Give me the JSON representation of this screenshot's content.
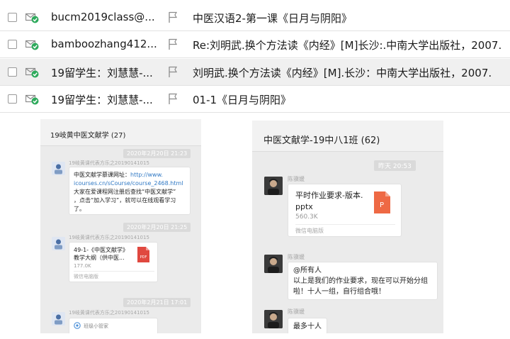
{
  "mail_list": [
    {
      "sender": "bucm2019class@...",
      "subject": "中医汉语2-第一课《日月与阴阳》",
      "selected": false
    },
    {
      "sender": "bamboozhang412...",
      "subject": "Re:刘明武.换个方法读《内经》[M]长沙:.中南大学出版社，2007.",
      "selected": false
    },
    {
      "sender": "19留学生：刘慧慧-...",
      "subject": "刘明武.换个方法读《内经》[M].长沙：中南大学出版社，2007.",
      "selected": true
    },
    {
      "sender": "19留学生：刘慧慧-...",
      "subject": "01-1《日月与阴阳》",
      "selected": false
    }
  ],
  "chat_left": {
    "title": "19岐黄中医文献学 (27)",
    "ts1": "2020年2月20日 21:23",
    "sender1": "19岐黄课代表方乐之20190141015",
    "msg1_line1_prefix": "中医文献学慕课网址：",
    "msg1_link1": "http://www.",
    "msg1_link2": "icourses.cn/sCourse/course_2468.html",
    "msg1_line3": "大家在爱课程网注册后查找“中医文献学”",
    "msg1_line4": "，点击“加入学习”，就可以在线观看学习",
    "msg1_line5": "了。",
    "ts2": "2020年2月20日 21:25",
    "sender2": "19岐黄课代表方乐之20190141015",
    "file_title1": "49-1-《中医文献学》",
    "file_title2": "教学大纲（供中医...",
    "file_size": "177.0K",
    "file_source": "微信电脑版",
    "file_icon_label": "PDF",
    "ts3": "2020年2月21日 17:01",
    "sender3": "19岐黄课代表方乐之20190141015",
    "partial_label": "班级小管家"
  },
  "chat_right": {
    "title": "中医文献学-19中八1班 (62)",
    "ts1": "昨天 20:53",
    "sender1": "陈骥媛",
    "file_title1": "平时作业要求-版本.",
    "file_title2": "pptx",
    "file_size": "560.3K",
    "file_source": "微信电脑版",
    "file_icon_label": "P",
    "sender2": "陈骥媛",
    "msg2_line1": "@所有人",
    "msg2_line2": "以上是我们的作业要求，现在可以开始分组",
    "msg2_line3": "啦！十人一组，自行组合哦！",
    "sender3": "陈骥媛",
    "msg3": "最多十人"
  },
  "colors": {
    "envelope": "#8a8a8a",
    "check_badge": "#2eaa5c",
    "link": "#2f78c4",
    "pdf_icon": "#e0483f",
    "pptx_icon": "#ee6944"
  }
}
